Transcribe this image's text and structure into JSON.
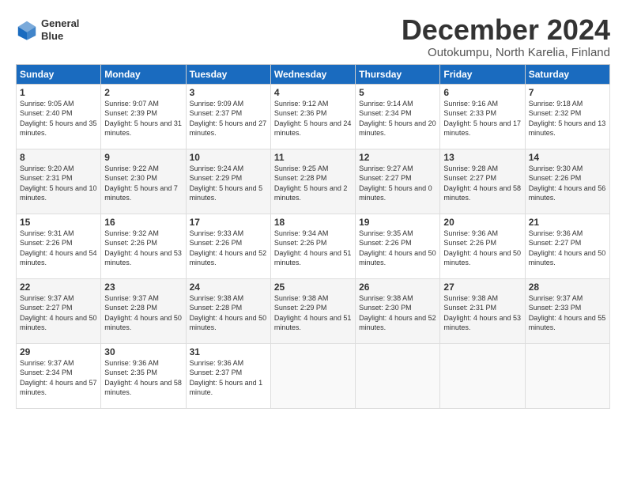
{
  "logo": {
    "line1": "General",
    "line2": "Blue"
  },
  "title": "December 2024",
  "subtitle": "Outokumpu, North Karelia, Finland",
  "days_of_week": [
    "Sunday",
    "Monday",
    "Tuesday",
    "Wednesday",
    "Thursday",
    "Friday",
    "Saturday"
  ],
  "weeks": [
    [
      {
        "day": "1",
        "sunrise": "9:05 AM",
        "sunset": "2:40 PM",
        "daylight": "5 hours and 35 minutes."
      },
      {
        "day": "2",
        "sunrise": "9:07 AM",
        "sunset": "2:39 PM",
        "daylight": "5 hours and 31 minutes."
      },
      {
        "day": "3",
        "sunrise": "9:09 AM",
        "sunset": "2:37 PM",
        "daylight": "5 hours and 27 minutes."
      },
      {
        "day": "4",
        "sunrise": "9:12 AM",
        "sunset": "2:36 PM",
        "daylight": "5 hours and 24 minutes."
      },
      {
        "day": "5",
        "sunrise": "9:14 AM",
        "sunset": "2:34 PM",
        "daylight": "5 hours and 20 minutes."
      },
      {
        "day": "6",
        "sunrise": "9:16 AM",
        "sunset": "2:33 PM",
        "daylight": "5 hours and 17 minutes."
      },
      {
        "day": "7",
        "sunrise": "9:18 AM",
        "sunset": "2:32 PM",
        "daylight": "5 hours and 13 minutes."
      }
    ],
    [
      {
        "day": "8",
        "sunrise": "9:20 AM",
        "sunset": "2:31 PM",
        "daylight": "5 hours and 10 minutes."
      },
      {
        "day": "9",
        "sunrise": "9:22 AM",
        "sunset": "2:30 PM",
        "daylight": "5 hours and 7 minutes."
      },
      {
        "day": "10",
        "sunrise": "9:24 AM",
        "sunset": "2:29 PM",
        "daylight": "5 hours and 5 minutes."
      },
      {
        "day": "11",
        "sunrise": "9:25 AM",
        "sunset": "2:28 PM",
        "daylight": "5 hours and 2 minutes."
      },
      {
        "day": "12",
        "sunrise": "9:27 AM",
        "sunset": "2:27 PM",
        "daylight": "5 hours and 0 minutes."
      },
      {
        "day": "13",
        "sunrise": "9:28 AM",
        "sunset": "2:27 PM",
        "daylight": "4 hours and 58 minutes."
      },
      {
        "day": "14",
        "sunrise": "9:30 AM",
        "sunset": "2:26 PM",
        "daylight": "4 hours and 56 minutes."
      }
    ],
    [
      {
        "day": "15",
        "sunrise": "9:31 AM",
        "sunset": "2:26 PM",
        "daylight": "4 hours and 54 minutes."
      },
      {
        "day": "16",
        "sunrise": "9:32 AM",
        "sunset": "2:26 PM",
        "daylight": "4 hours and 53 minutes."
      },
      {
        "day": "17",
        "sunrise": "9:33 AM",
        "sunset": "2:26 PM",
        "daylight": "4 hours and 52 minutes."
      },
      {
        "day": "18",
        "sunrise": "9:34 AM",
        "sunset": "2:26 PM",
        "daylight": "4 hours and 51 minutes."
      },
      {
        "day": "19",
        "sunrise": "9:35 AM",
        "sunset": "2:26 PM",
        "daylight": "4 hours and 50 minutes."
      },
      {
        "day": "20",
        "sunrise": "9:36 AM",
        "sunset": "2:26 PM",
        "daylight": "4 hours and 50 minutes."
      },
      {
        "day": "21",
        "sunrise": "9:36 AM",
        "sunset": "2:27 PM",
        "daylight": "4 hours and 50 minutes."
      }
    ],
    [
      {
        "day": "22",
        "sunrise": "9:37 AM",
        "sunset": "2:27 PM",
        "daylight": "4 hours and 50 minutes."
      },
      {
        "day": "23",
        "sunrise": "9:37 AM",
        "sunset": "2:28 PM",
        "daylight": "4 hours and 50 minutes."
      },
      {
        "day": "24",
        "sunrise": "9:38 AM",
        "sunset": "2:28 PM",
        "daylight": "4 hours and 50 minutes."
      },
      {
        "day": "25",
        "sunrise": "9:38 AM",
        "sunset": "2:29 PM",
        "daylight": "4 hours and 51 minutes."
      },
      {
        "day": "26",
        "sunrise": "9:38 AM",
        "sunset": "2:30 PM",
        "daylight": "4 hours and 52 minutes."
      },
      {
        "day": "27",
        "sunrise": "9:38 AM",
        "sunset": "2:31 PM",
        "daylight": "4 hours and 53 minutes."
      },
      {
        "day": "28",
        "sunrise": "9:37 AM",
        "sunset": "2:33 PM",
        "daylight": "4 hours and 55 minutes."
      }
    ],
    [
      {
        "day": "29",
        "sunrise": "9:37 AM",
        "sunset": "2:34 PM",
        "daylight": "4 hours and 57 minutes."
      },
      {
        "day": "30",
        "sunrise": "9:36 AM",
        "sunset": "2:35 PM",
        "daylight": "4 hours and 58 minutes."
      },
      {
        "day": "31",
        "sunrise": "9:36 AM",
        "sunset": "2:37 PM",
        "daylight": "5 hours and 1 minute."
      },
      null,
      null,
      null,
      null
    ]
  ]
}
